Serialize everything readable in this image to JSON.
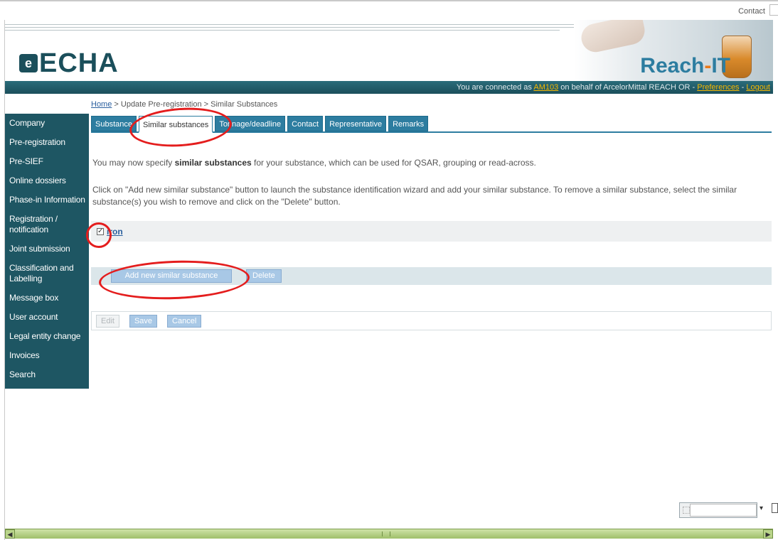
{
  "top": {
    "contact": "Contact"
  },
  "header": {
    "logo_mark": "e",
    "logo_text": "ECHA",
    "brand": "Reach",
    "brand_dash": "-",
    "brand_suffix": "IT"
  },
  "connection": {
    "prefix": "You are connected as ",
    "user": "AM103",
    "middle": " on behalf of ArcelorMittal REACH OR - ",
    "preferences": "Preferences",
    "sep": " - ",
    "logout": "Logout"
  },
  "breadcrumb": {
    "home": "Home",
    "trail": " > Update Pre-registration > Similar Substances"
  },
  "sidebar": {
    "items": [
      {
        "label": "Company"
      },
      {
        "label": "Pre-registration"
      },
      {
        "label": "Pre-SIEF"
      },
      {
        "label": "Online dossiers"
      },
      {
        "label": "Phase-in Information"
      },
      {
        "label": "Registration / notification"
      },
      {
        "label": "Joint submission"
      },
      {
        "label": "Classification and Labelling"
      },
      {
        "label": "Message box"
      },
      {
        "label": "User account"
      },
      {
        "label": "Legal entity change"
      },
      {
        "label": "Invoices"
      },
      {
        "label": "Search"
      }
    ]
  },
  "tabs": [
    {
      "label": "Substance"
    },
    {
      "label": "Similar substances"
    },
    {
      "label": "Tonnage/deadline"
    },
    {
      "label": "Contact"
    },
    {
      "label": "Representative"
    },
    {
      "label": "Remarks"
    }
  ],
  "content": {
    "intro_prefix": "You may now specify ",
    "intro_bold": "similar substances",
    "intro_suffix": " for your substance, which can be used for QSAR, grouping or read-across.",
    "instructions": "Click on \"Add new similar substance\" button to launch the substance identification wizard and add your similar substance. To remove a similar substance, select the similar substance(s) you wish to remove and click on the \"Delete\" button.",
    "substance_checkbox": "✓",
    "substance_name": "iron",
    "add_button": "Add new similar substance",
    "delete_button": "Delete",
    "edit_button": "Edit",
    "save_button": "Save",
    "cancel_button": "Cancel"
  },
  "widgets": {
    "dropdown_arrow": "▾"
  },
  "colors": {
    "sidebar": "#1e5663",
    "tab": "#2d7da0",
    "annotation": "#e41d1d"
  }
}
